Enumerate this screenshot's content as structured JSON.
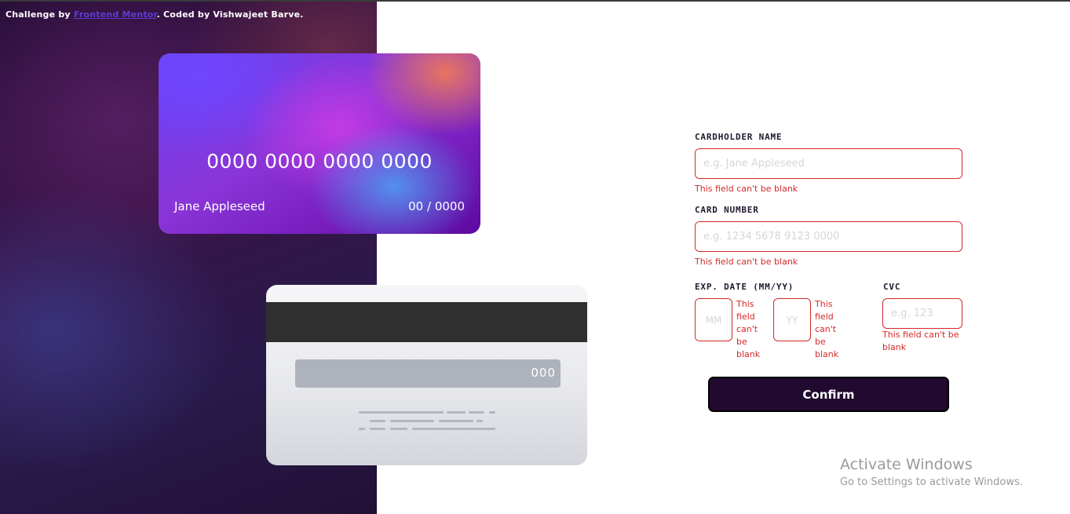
{
  "attribution": {
    "prefix": "Challenge by ",
    "link_text": "Frontend Mentor",
    "suffix": ". Coded by Vishwajeet Barve."
  },
  "card_front": {
    "number": "0000 0000 0000 0000",
    "name": "Jane Appleseed",
    "expiry": "00 / 0000"
  },
  "card_back": {
    "cvc": "000"
  },
  "form": {
    "cardholder_label": "CARDHOLDER NAME",
    "cardholder_placeholder": "e.g. Jane Appleseed",
    "cardholder_value": "",
    "cardholder_error": "This field can't be blank",
    "number_label": "CARD NUMBER",
    "number_placeholder": "e.g. 1234 5678 9123 0000",
    "number_value": "",
    "number_error": "This field can't be blank",
    "exp_label": "EXP. DATE (MM/YY)",
    "month_placeholder": "MM",
    "month_value": "",
    "month_error": "This field can't be blank",
    "year_placeholder": "YY",
    "year_value": "",
    "year_error": "This field can't be blank",
    "cvc_label": "CVC",
    "cvc_placeholder": "e.g. 123",
    "cvc_value": "",
    "cvc_error": "This field can't be blank",
    "confirm_label": "Confirm"
  },
  "watermark": {
    "title": "Activate Windows",
    "subtitle": "Go to Settings to activate Windows."
  },
  "colors": {
    "error": "#d62828",
    "button_bg": "#21092f",
    "label_text": "#22182e"
  }
}
